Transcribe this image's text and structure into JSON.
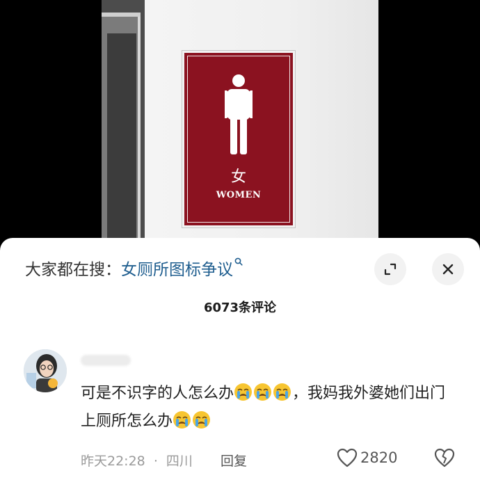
{
  "video": {
    "sign_character": "女",
    "sign_text": "WOMEN"
  },
  "panel": {
    "search_prefix": "大家都在搜：",
    "search_term": "女厕所图标争议",
    "comment_count": "6073条评论"
  },
  "comment": {
    "text_part1": "可是不识字的人怎么办",
    "text_part2": "，我妈我外婆她们出门上厕所怎么办",
    "time": "昨天22:28",
    "separator": "·",
    "location": "四川",
    "reply_label": "回复",
    "likes": "2820"
  },
  "icons": {
    "search": "search-icon",
    "expand": "expand-icon",
    "close": "close-icon",
    "like": "heart-icon",
    "dislike": "broken-heart-icon",
    "emoji": "crying-face-emoji"
  },
  "colors": {
    "sign_red": "#8b1220",
    "link_blue": "#1f5e8f",
    "emoji_yellow": "#f7c531"
  }
}
